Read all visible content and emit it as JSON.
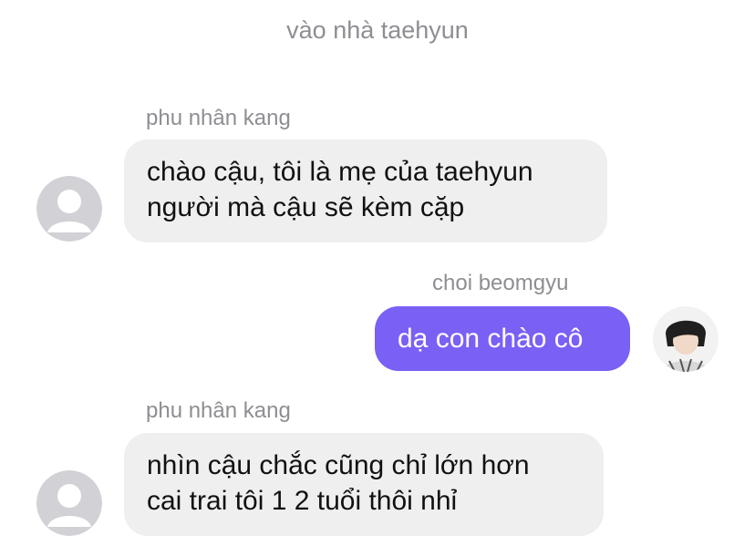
{
  "chat": {
    "title": "vào nhà taehyun"
  },
  "messages": [
    {
      "sender": "phu nhân kang",
      "direction": "incoming",
      "lines": [
        "chào cậu, tôi là mẹ của taehyun",
        "người mà cậu sẽ kèm cặp"
      ],
      "avatar_icon": "default-person-avatar-icon"
    },
    {
      "sender": "choi beomgyu",
      "direction": "outgoing",
      "lines": [
        "dạ con chào cô"
      ],
      "avatar_icon": "profile-photo-avatar"
    },
    {
      "sender": "phu nhân kang",
      "direction": "incoming",
      "lines": [
        "nhìn cậu chắc cũng chỉ lớn hơn",
        "cai trai tôi 1 2 tuổi thôi nhỉ"
      ],
      "avatar_icon": "default-person-avatar-icon"
    }
  ],
  "colors": {
    "incoming_bubble": "#efeff0",
    "outgoing_bubble": "#7a60f5",
    "meta_text": "#8e8e93",
    "default_avatar_bg": "#d1d1d6"
  }
}
